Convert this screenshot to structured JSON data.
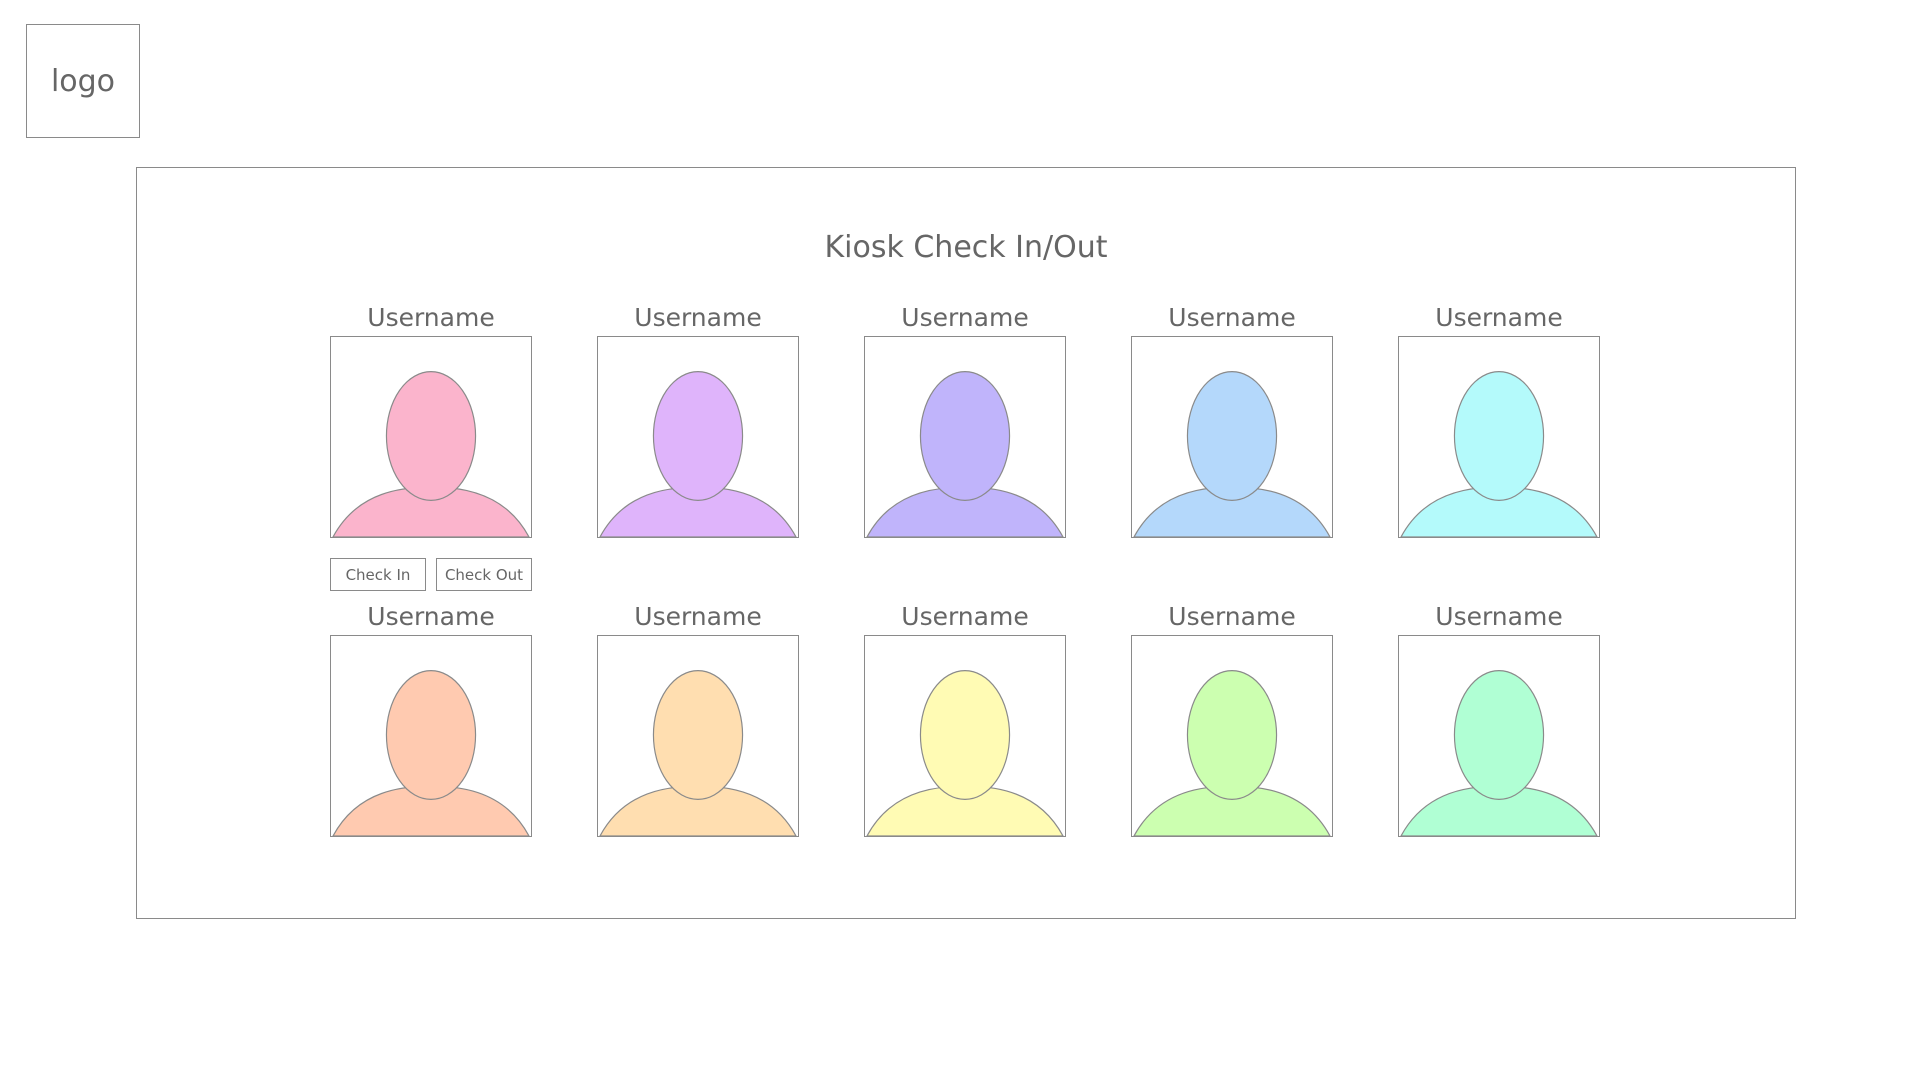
{
  "logo": {
    "text": "logo"
  },
  "page": {
    "title": "Kiosk Check In/Out"
  },
  "users": [
    {
      "name": "Username",
      "color": "#FBB4CC"
    },
    {
      "name": "Username",
      "color": "#DFB4FB"
    },
    {
      "name": "Username",
      "color": "#C0B4FB"
    },
    {
      "name": "Username",
      "color": "#B4D8FB"
    },
    {
      "name": "Username",
      "color": "#B4FAFB"
    },
    {
      "name": "Username",
      "color": "#FFCAB0"
    },
    {
      "name": "Username",
      "color": "#FFDEB0"
    },
    {
      "name": "Username",
      "color": "#FFFBB4"
    },
    {
      "name": "Username",
      "color": "#CCFFB0"
    },
    {
      "name": "Username",
      "color": "#B0FFD4"
    }
  ],
  "actions": {
    "check_in_label": "Check In",
    "check_out_label": "Check Out"
  },
  "outline_color": "#8a8a8a"
}
